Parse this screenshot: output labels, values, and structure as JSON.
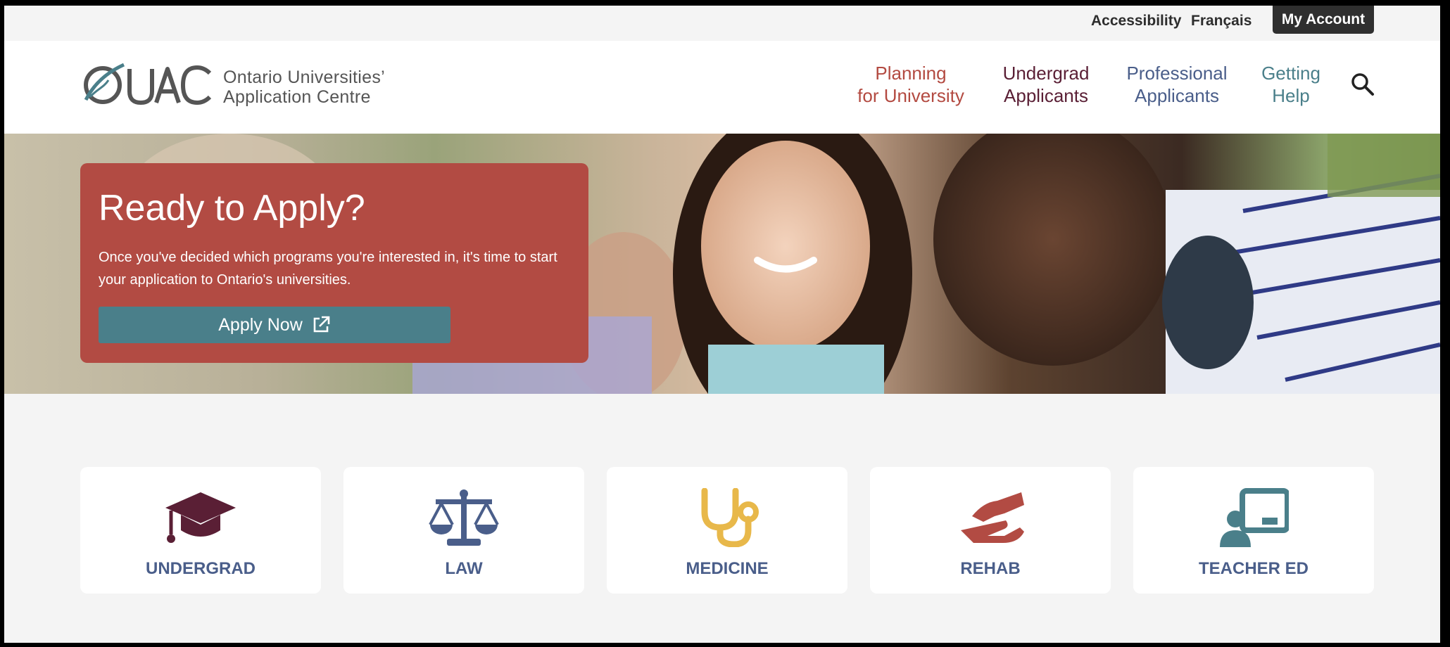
{
  "utility": {
    "accessibility": "Accessibility",
    "francais": "Français",
    "my_account": "My Account"
  },
  "logo": {
    "mark": "OUAC",
    "line1": "Ontario Universities’",
    "line2": "Application Centre"
  },
  "nav": [
    {
      "line1": "Planning",
      "line2": "for University"
    },
    {
      "line1": "Undergrad",
      "line2": "Applicants"
    },
    {
      "line1": "Professional",
      "line2": "Applicants"
    },
    {
      "line1": "Getting",
      "line2": "Help"
    }
  ],
  "search": {
    "icon": "search-icon"
  },
  "hero": {
    "title": "Ready to Apply?",
    "description": "Once you've decided which programs you're interested in, it's time to start your application to Ontario's universities.",
    "button": "Apply Now",
    "button_icon": "external-link-icon"
  },
  "cards": [
    {
      "label": "UNDERGRAD",
      "icon": "graduation-cap-icon",
      "color": "#5a1f35"
    },
    {
      "label": "LAW",
      "icon": "scales-icon",
      "color": "#4a5e8a"
    },
    {
      "label": "MEDICINE",
      "icon": "stethoscope-icon",
      "color": "#e8b84a"
    },
    {
      "label": "REHAB",
      "icon": "helping-hand-icon",
      "color": "#b24b43"
    },
    {
      "label": "TEACHER ED",
      "icon": "teacher-icon",
      "color": "#4a7f8a"
    }
  ],
  "colors": {
    "brand_red": "#b24b43",
    "brand_teal": "#4a7f8a",
    "brand_maroon": "#5a1f35",
    "brand_blue": "#4a5e8a",
    "brand_gold": "#e8b84a"
  }
}
